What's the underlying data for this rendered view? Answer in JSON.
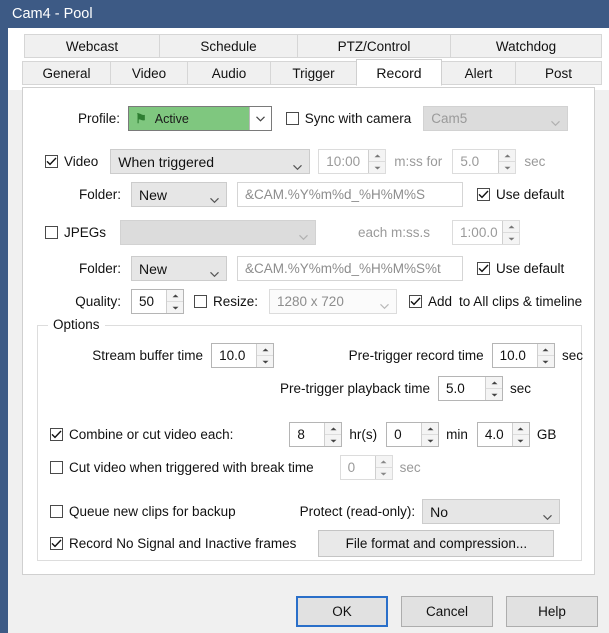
{
  "window": {
    "title": "Cam4 - Pool"
  },
  "tabs": {
    "top_row": [
      "Webcast",
      "Schedule",
      "PTZ/Control",
      "Watchdog"
    ],
    "bottom_row": [
      "General",
      "Video",
      "Audio",
      "Trigger",
      "Record",
      "Alert",
      "Post"
    ],
    "active": "Record"
  },
  "profile": {
    "label": "Profile:",
    "value": "Active",
    "flag_icon": "flag-glyph",
    "sync_label": "Sync with camera",
    "sync_checked": false,
    "camera_value": "Cam5"
  },
  "video": {
    "label": "Video",
    "checked": true,
    "mode": "When triggered",
    "duration": "10:00",
    "duration_unit": "m:ss for",
    "post": "5.0",
    "post_unit": "sec",
    "folder_label": "Folder:",
    "folder_mode": "New",
    "folder_path": "&CAM.%Y%m%d_%H%M%S",
    "use_default_label": "Use default",
    "use_default_checked": true
  },
  "jpegs": {
    "label": "JPEGs",
    "checked": false,
    "mode": "",
    "each_label": "each m:ss.s",
    "interval": "1:00.0",
    "folder_label": "Folder:",
    "folder_mode": "New",
    "folder_path": "&CAM.%Y%m%d_%H%M%S%t",
    "use_default_label": "Use default",
    "use_default_checked": true,
    "quality_label": "Quality:",
    "quality": "50",
    "resize_label": "Resize:",
    "resize_checked": false,
    "resize_value": "1280 x 720",
    "add_label": "Add",
    "add_checked": true,
    "add_suffix": "to All clips & timeline"
  },
  "options": {
    "title": "Options",
    "stream_buffer_label": "Stream buffer time",
    "stream_buffer": "10.0",
    "pretrigger_record_label": "Pre-trigger record time",
    "pretrigger_record": "10.0",
    "pretrigger_record_unit": "sec",
    "pretrigger_playback_label": "Pre-trigger playback time",
    "pretrigger_playback": "5.0",
    "pretrigger_playback_unit": "sec",
    "combine_label": "Combine or cut video each:",
    "combine_checked": true,
    "combine_hours": "8",
    "combine_hours_unit": "hr(s)",
    "combine_min": "0",
    "combine_min_unit": "min",
    "combine_gb": "4.0",
    "combine_gb_unit": "GB",
    "cut_label": "Cut video when triggered with break time",
    "cut_checked": false,
    "cut_sec": "0",
    "cut_sec_unit": "sec",
    "queue_label": "Queue new clips for backup",
    "queue_checked": false,
    "protect_label": "Protect (read-only):",
    "protect_value": "No",
    "nosignal_label": "Record No Signal and Inactive frames",
    "nosignal_checked": true,
    "file_format_button": "File format and compression..."
  },
  "footer": {
    "ok": "OK",
    "cancel": "Cancel",
    "help": "Help"
  },
  "colors": {
    "titlebar": "#3d5a85",
    "profile_green": "#7fc77f",
    "default_button_border": "#2a6fc9"
  }
}
